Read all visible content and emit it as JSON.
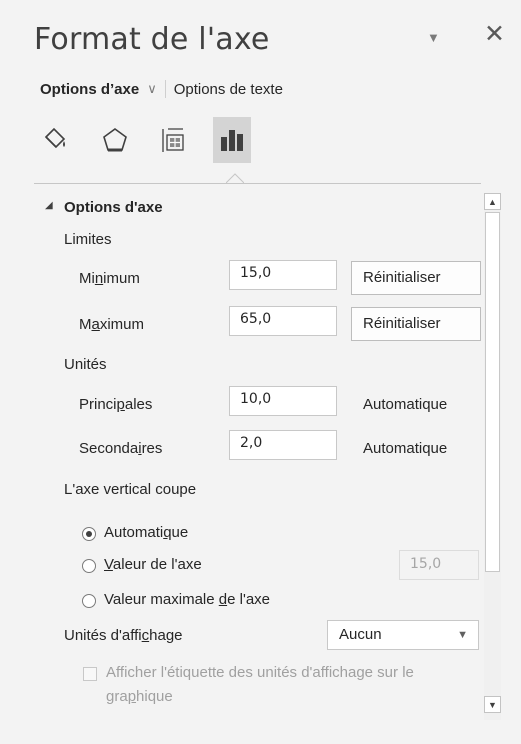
{
  "pane": {
    "title": "Format de l'axe",
    "caret_icon": "chevron-down-icon",
    "close_icon": "close-icon"
  },
  "tabs": {
    "active": "Options d’axe",
    "other": "Options de texte"
  },
  "icon_tabs": [
    "fill-line-icon",
    "effects-pentagon-icon",
    "size-properties-icon",
    "axis-options-bar-chart-icon"
  ],
  "section": {
    "title": "Options d'axe",
    "limits": {
      "label": "Limites",
      "min_label_pre": "Mi",
      "min_label_ul": "n",
      "min_label_post": "imum",
      "min_value": "15,0",
      "max_label_pre": "M",
      "max_label_ul": "a",
      "max_label_post": "ximum",
      "max_value": "65,0",
      "reset_label": "Réinitialiser"
    },
    "units": {
      "label": "Unités",
      "major_label_pre": "Princi",
      "major_label_ul": "p",
      "major_label_post": "ales",
      "major_value": "10,0",
      "major_status": "Automatique",
      "minor_label_pre": "Seconda",
      "minor_label_ul": "i",
      "minor_label_post": "res",
      "minor_value": "2,0",
      "minor_status": "Automatique"
    },
    "crosses": {
      "label": "L'axe vertical coupe",
      "auto_pre": "Automati",
      "auto_ul": "q",
      "auto_post": "ue",
      "value_ul": "V",
      "value_post": "aleur de l'axe",
      "value_field": "15,0",
      "max_pre": "Valeur maximale ",
      "max_ul": "d",
      "max_post": "e l'axe",
      "selected": "Automatique"
    },
    "display_units": {
      "label_pre": "Unités d'affi",
      "label_ul": "c",
      "label_post": "hage",
      "value": "Aucun",
      "checkbox_line1": "Afficher l'étiquette des unités d'affichage sur le",
      "checkbox_line2_pre": "gra",
      "checkbox_line2_ul": "p",
      "checkbox_line2_post": "hique"
    }
  }
}
